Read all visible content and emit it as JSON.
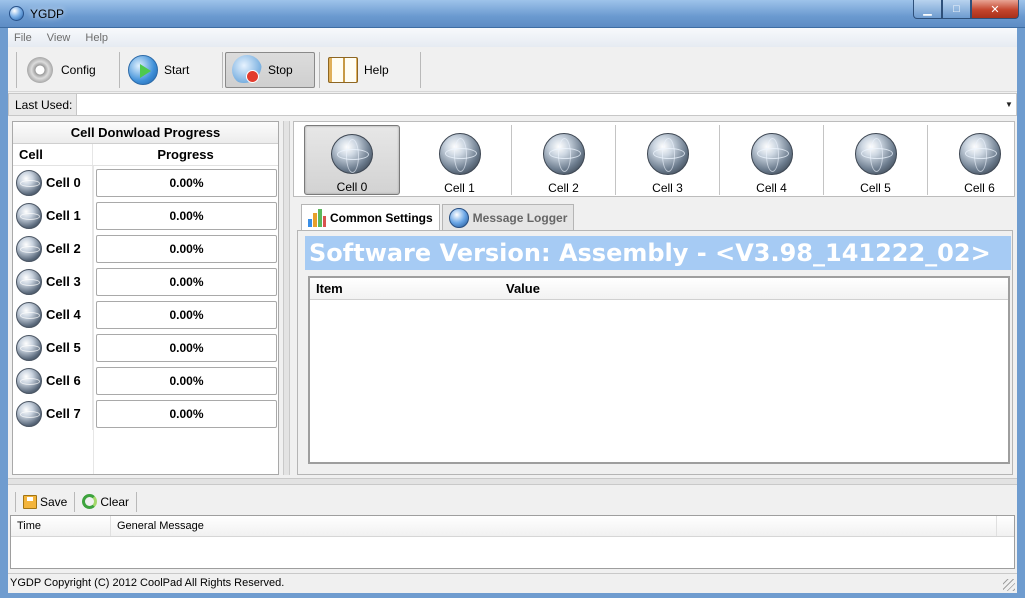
{
  "window": {
    "title": "YGDP"
  },
  "menu": {
    "items": [
      "File",
      "View",
      "Help"
    ]
  },
  "toolbar": {
    "config_label": "Config",
    "start_label": "Start",
    "stop_label": "Stop",
    "help_label": "Help"
  },
  "last_used": {
    "label": "Last Used:",
    "value": ""
  },
  "progress_panel": {
    "caption": "Cell Donwload Progress",
    "col_cell": "Cell",
    "col_progress": "Progress",
    "rows": [
      {
        "cell": "Cell 0",
        "progress": "0.00%"
      },
      {
        "cell": "Cell 1",
        "progress": "0.00%"
      },
      {
        "cell": "Cell 2",
        "progress": "0.00%"
      },
      {
        "cell": "Cell 3",
        "progress": "0.00%"
      },
      {
        "cell": "Cell 4",
        "progress": "0.00%"
      },
      {
        "cell": "Cell 5",
        "progress": "0.00%"
      },
      {
        "cell": "Cell 6",
        "progress": "0.00%"
      },
      {
        "cell": "Cell 7",
        "progress": "0.00%"
      }
    ]
  },
  "cell_selector": {
    "selected": "Cell 0",
    "cells": [
      "Cell 0",
      "Cell 1",
      "Cell 2",
      "Cell 3",
      "Cell 4",
      "Cell 5",
      "Cell 6"
    ]
  },
  "tabs": [
    {
      "label": "Common Settings",
      "active": true
    },
    {
      "label": "Message Logger",
      "active": false
    }
  ],
  "settings": {
    "version_text": "Software Version:  Assembly - <V3.98_141222_02>",
    "col_item": "Item",
    "col_value": "Value"
  },
  "logger": {
    "save_label": "Save",
    "clear_label": "Clear",
    "col_time": "Time",
    "col_message": "General Message"
  },
  "status": {
    "text": "YGDP Copyright (C) 2012 CoolPad All Rights Reserved."
  },
  "colors": {
    "version_banner": "#a6cbf4",
    "titlebar": "#6b9ad0",
    "close_button": "#c4452d"
  }
}
